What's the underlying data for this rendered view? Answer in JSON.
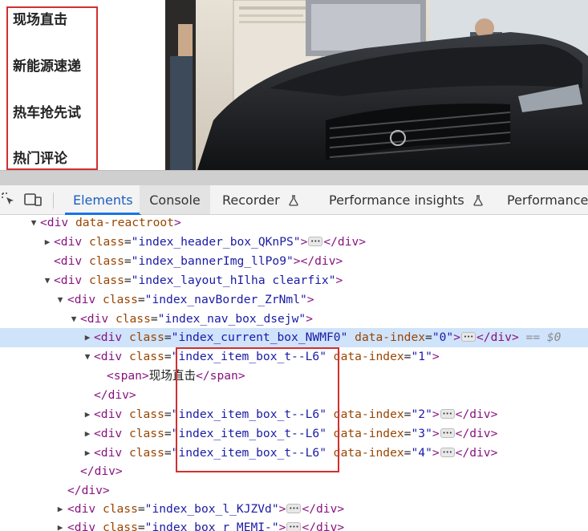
{
  "page": {
    "nav_items": [
      "现场直击",
      "新能源速递",
      "热车抢先试",
      "热门评论"
    ]
  },
  "devtools": {
    "tabs": [
      {
        "label": "Elements",
        "active": true
      },
      {
        "label": "Console",
        "active": false
      },
      {
        "label": "Recorder",
        "active": false
      },
      {
        "label": "Performance insights",
        "active": false
      },
      {
        "label": "Performance",
        "active": false
      }
    ],
    "icons": [
      "inspect-element-icon",
      "device-toolbar-icon",
      "flask-icon"
    ],
    "dom_tree": {
      "rows": [
        {
          "tag": "div",
          "attr": "data-reactroot",
          "text": "<div data-reactroot>"
        },
        {
          "class": "index_header_box_QKnPS"
        },
        {
          "class": "index_bannerImg_llPo9"
        },
        {
          "class": "index_layout_hIlha clearfix"
        },
        {
          "class": "index_navBorder_ZrNml"
        },
        {
          "class": "index_nav_box_dsejw"
        },
        {
          "class": "index_current_box_NWMF0",
          "data_index": "0",
          "selected_marker": "== $0"
        },
        {
          "class": "index_item_box_t--L6",
          "data_index": "1"
        },
        {
          "span_text": "现场直击"
        },
        {
          "close": "</div>"
        },
        {
          "class": "index_item_box_t--L6",
          "data_index": "2"
        },
        {
          "class": "index_item_box_t--L6",
          "data_index": "3"
        },
        {
          "class": "index_item_box_t--L6",
          "data_index": "4"
        },
        {
          "close": "</div>"
        },
        {
          "close": "</div>"
        },
        {
          "class": "index_box_l_KJZVd"
        },
        {
          "class": "index_box_r_MEMI-"
        }
      ]
    }
  },
  "colors": {
    "highlight_border": "#d32f2f",
    "selected_row": "#cfe3fb",
    "tag": "#881280",
    "attr_name": "#994500",
    "attr_value": "#1a1aa6",
    "active_tab": "#1a73e8"
  }
}
